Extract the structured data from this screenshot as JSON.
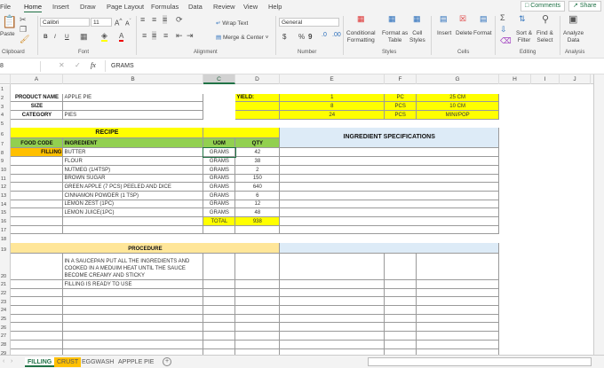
{
  "ribbon_tabs": [
    "File",
    "Home",
    "Insert",
    "Draw",
    "Page Layout",
    "Formulas",
    "Data",
    "Review",
    "View",
    "Help"
  ],
  "active_tab": "Home",
  "comments_label": "Comments",
  "share_label": "Share",
  "clipboard": {
    "paste": "Paste",
    "group": "Clipboard"
  },
  "font": {
    "name": "Calibri",
    "size": "11",
    "group": "Font",
    "bold": "B",
    "italic": "I",
    "underline": "U"
  },
  "alignment": {
    "wrap": "Wrap Text",
    "merge": "Merge & Center",
    "group": "Alignment"
  },
  "number": {
    "format": "General",
    "currency": "$",
    "percent": "%",
    "comma": "9",
    "group": "Number"
  },
  "styles": {
    "conditional": [
      "Conditional",
      "Formatting"
    ],
    "table": [
      "Format as",
      "Table"
    ],
    "cell": [
      "Cell",
      "Styles"
    ],
    "group": "Styles"
  },
  "cells": {
    "insert": "Insert",
    "delete": "Delete",
    "format": "Format",
    "group": "Cells"
  },
  "editing": {
    "sort": [
      "Sort &",
      "Filter"
    ],
    "find": [
      "Find &",
      "Select"
    ],
    "group": "Editing"
  },
  "analysis": {
    "analyze": [
      "Analyze",
      "Data"
    ],
    "group": "Analysis"
  },
  "formula_bar": {
    "name_box": "8",
    "fx": "fx",
    "value": "GRAMS"
  },
  "columns": [
    "A",
    "B",
    "C",
    "D",
    "E",
    "F",
    "G",
    "H",
    "I",
    "J"
  ],
  "selected_column": "C",
  "product": {
    "name_label": "PRODUCT NAME",
    "name": "APPLE PIE",
    "size_label": "SIZE",
    "category_label": "CATEGORY",
    "category": "PIES"
  },
  "yield": {
    "label": "YIELD:",
    "rows": [
      [
        "1",
        "PC",
        "25 CM"
      ],
      [
        "8",
        "PCS",
        "10 CM"
      ],
      [
        "24",
        "PCS",
        "MINI/POP"
      ]
    ]
  },
  "recipe": {
    "title": "RECIPE",
    "headers": [
      "FOOD CODE",
      "INGREDIENT",
      "UOM",
      "QTY"
    ],
    "food_code": "FILLING",
    "items": [
      [
        "BUTTER",
        "GRAMS",
        "42"
      ],
      [
        "FLOUR",
        "GRAMS",
        "38"
      ],
      [
        "NUTMEG (1/4TSP)",
        "GRAMS",
        "2"
      ],
      [
        "BROWN SUGAR",
        "GRAMS",
        "150"
      ],
      [
        "GREEN APPLE (7 PCS) PEELED AND DICE",
        "GRAMS",
        "640"
      ],
      [
        "CINNAMON POWDER (1 TSP)",
        "GRAMS",
        "6"
      ],
      [
        "LEMON ZEST (1PC)",
        "GRAMS",
        "12"
      ],
      [
        "LEMON JUICE(1PC)",
        "GRAMS",
        "48"
      ]
    ],
    "total_label": "TOTAL",
    "total": "938"
  },
  "ingredient_specs": {
    "title": "INGREDIENT SPECIFICATIONS"
  },
  "procedure": {
    "title": "PROCEDURE",
    "steps": [
      "IN A SAUCEPAN PUT ALL THE INGREDIENTS AND COOKED IN A MEDUIM HEAT UNTIL THE SAUCE BECOME CREAMY AND STICKY",
      "FILLING IS READY TO USE"
    ]
  },
  "sheets": [
    "FILLING",
    "CRUST",
    "EGGWASH",
    "APPPLE PIE"
  ],
  "active_sheet": "FILLING",
  "colors": {
    "yellow": "#ffff00",
    "green": "#92d050",
    "orange": "#ffc000",
    "blue": "#ddebf7",
    "procedure": "#ffe699",
    "excel_green": "#217346"
  }
}
